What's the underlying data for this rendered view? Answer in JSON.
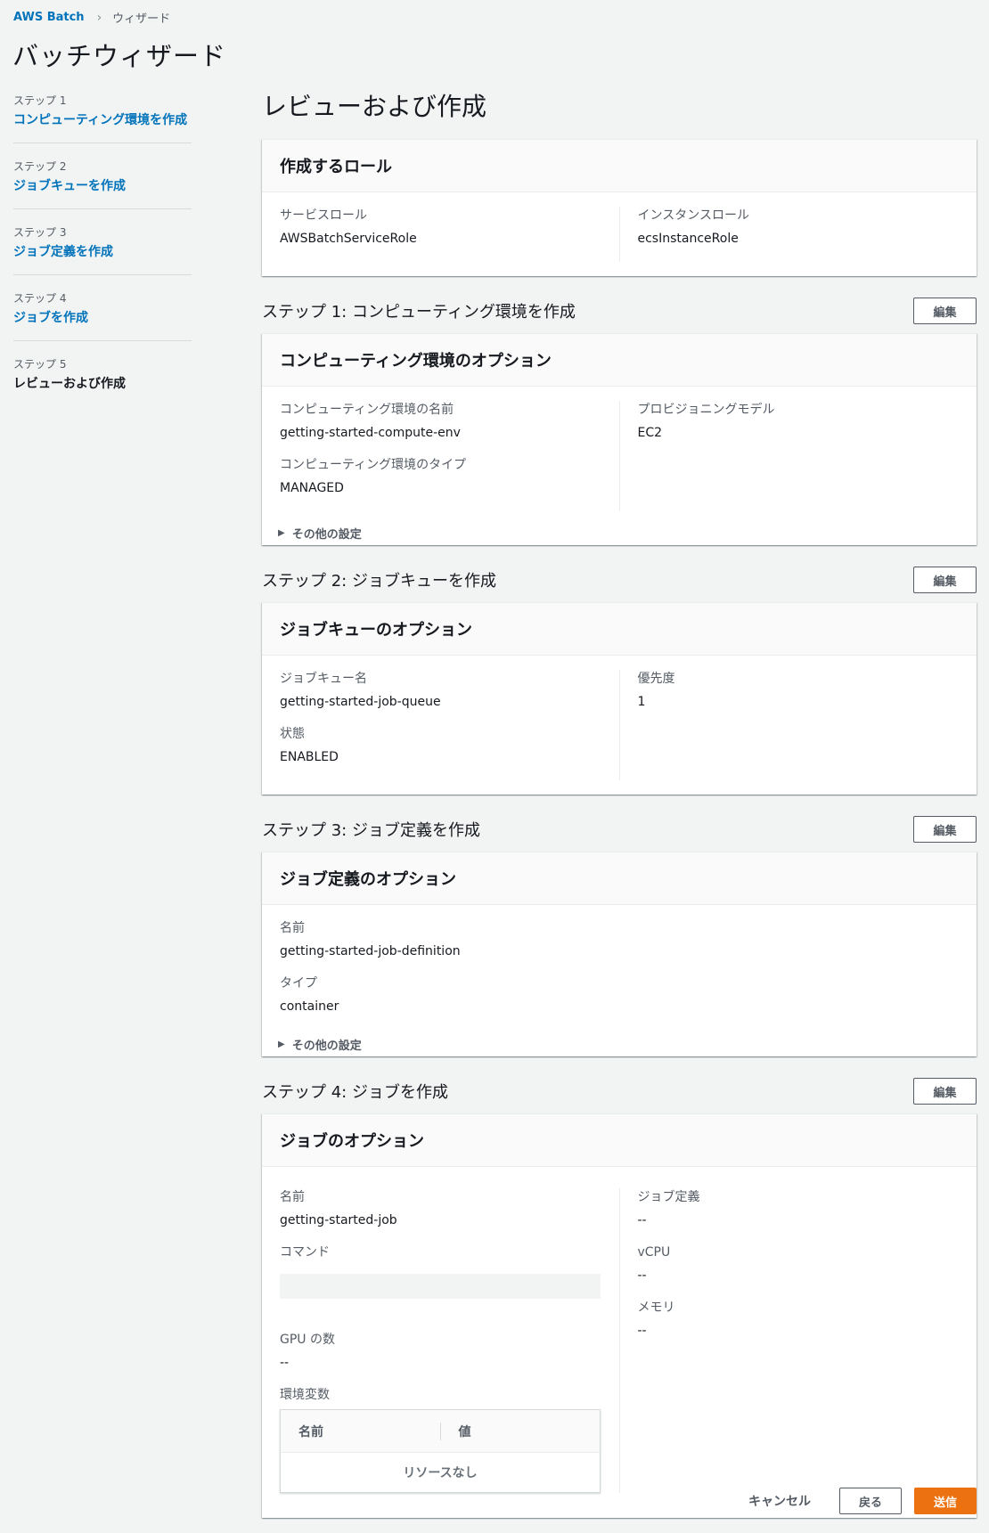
{
  "breadcrumb": {
    "root": "AWS Batch",
    "current": "ウィザード"
  },
  "wizard_title": "バッチウィザード",
  "steps": [
    {
      "num": "ステップ 1",
      "name": "コンピューティング環境を作成"
    },
    {
      "num": "ステップ 2",
      "name": "ジョブキューを作成"
    },
    {
      "num": "ステップ 3",
      "name": "ジョブ定義を作成"
    },
    {
      "num": "ステップ 4",
      "name": "ジョブを作成"
    },
    {
      "num": "ステップ 5",
      "name": "レビューおよび作成"
    }
  ],
  "page_title": "レビューおよび作成",
  "roles": {
    "header": "作成するロール",
    "service_role_label": "サービスロール",
    "service_role_value": "AWSBatchServiceRole",
    "instance_role_label": "インスタンスロール",
    "instance_role_value": "ecsInstanceRole"
  },
  "edit_label": "編集",
  "more_settings_label": "その他の設定",
  "step1": {
    "title": "ステップ 1: コンピューティング環境を作成",
    "header": "コンピューティング環境のオプション",
    "name_label": "コンピューティング環境の名前",
    "name_value": "getting-started-compute-env",
    "type_label": "コンピューティング環境のタイプ",
    "type_value": "MANAGED",
    "provisioning_label": "プロビジョニングモデル",
    "provisioning_value": "EC2"
  },
  "step2": {
    "title": "ステップ 2: ジョブキューを作成",
    "header": "ジョブキューのオプション",
    "queue_label": "ジョブキュー名",
    "queue_value": "getting-started-job-queue",
    "state_label": "状態",
    "state_value": "ENABLED",
    "priority_label": "優先度",
    "priority_value": "1"
  },
  "step3": {
    "title": "ステップ 3: ジョブ定義を作成",
    "header": "ジョブ定義のオプション",
    "name_label": "名前",
    "name_value": "getting-started-job-definition",
    "type_label": "タイプ",
    "type_value": "container"
  },
  "step4": {
    "title": "ステップ 4: ジョブを作成",
    "header": "ジョブのオプション",
    "name_label": "名前",
    "name_value": "getting-started-job",
    "command_label": "コマンド",
    "gpu_label": "GPU の数",
    "gpu_value": "--",
    "env_label": "環境変数",
    "env_col_name": "名前",
    "env_col_value": "値",
    "env_empty": "リソースなし",
    "jobdef_label": "ジョブ定義",
    "jobdef_value": "--",
    "vcpu_label": "vCPU",
    "vcpu_value": "--",
    "memory_label": "メモリ",
    "memory_value": "--"
  },
  "footer": {
    "cancel": "キャンセル",
    "back": "戻る",
    "submit": "送信"
  }
}
